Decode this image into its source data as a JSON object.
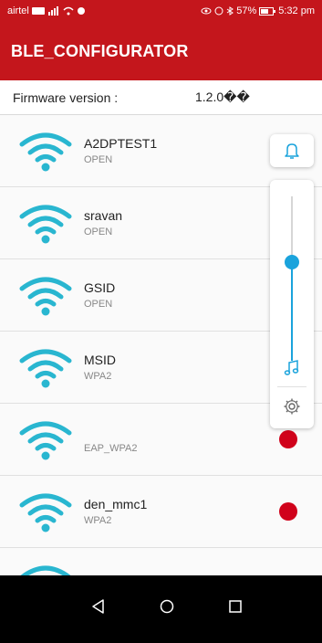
{
  "status": {
    "carrier": "airtel",
    "battery": "57%",
    "time": "5:32 pm"
  },
  "appbar": {
    "title": "BLE_CONFIGURATOR"
  },
  "firmware": {
    "label": "Firmware version :",
    "value": "1.2.0��"
  },
  "networks": [
    {
      "ssid": "A2DPTEST1",
      "security": "OPEN"
    },
    {
      "ssid": "sravan",
      "security": "OPEN"
    },
    {
      "ssid": "GSID",
      "security": "OPEN"
    },
    {
      "ssid": "MSID",
      "security": "WPA2"
    },
    {
      "ssid": "",
      "security": "EAP_WPA2"
    },
    {
      "ssid": "den_mmc1",
      "security": "WPA2"
    }
  ],
  "volume": {
    "level": 0.6
  },
  "colors": {
    "accent": "#c4161c",
    "wifi": "#29b6d0",
    "dot": "#d0021b",
    "slider": "#1aa3dc"
  },
  "icons": {
    "wifi": "wifi-icon",
    "bell": "bell-icon",
    "music": "music-note-icon",
    "gear": "gear-icon",
    "back": "back-icon",
    "home": "home-icon",
    "recents": "recents-icon"
  }
}
